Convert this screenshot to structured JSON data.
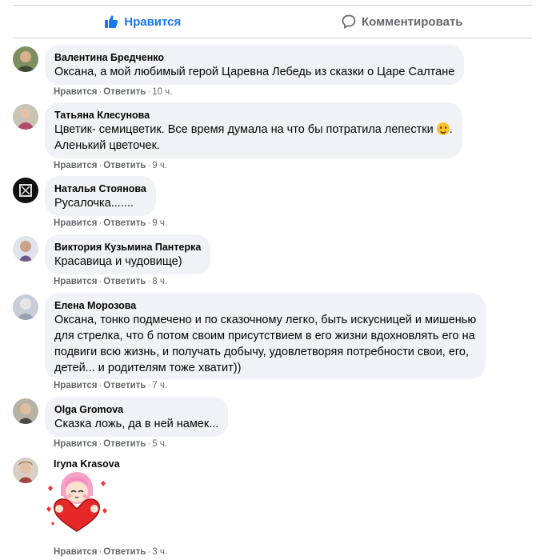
{
  "actions": {
    "like_label": "Нравится",
    "comment_label": "Комментировать"
  },
  "colors": {
    "accent": "#1877f2",
    "bubble": "#f0f2f5",
    "meta": "#65676b"
  },
  "comment_actions": {
    "like": "Нравится",
    "reply": "Ответить",
    "separator": "·"
  },
  "comments": [
    {
      "author": "Валентина Бредченко",
      "lines": [
        "Оксана, а мой любимый герой Царевна Лебедь из сказки о Царе Салтане"
      ],
      "time": "10 ч."
    },
    {
      "author": "Татьяна Клесунова",
      "lines": [
        "Цветик- семицветик. Все время думала на что бы потратила лепестки",
        "Аленький цветочек."
      ],
      "emoji": "grinning-face-emoji",
      "time": "9 ч."
    },
    {
      "author": "Наталья Стоянова",
      "lines": [
        "Русалочка......."
      ],
      "time": "9 ч."
    },
    {
      "author": "Виктория Кузьмина Пантерка",
      "lines": [
        "Красавица и чудовище)"
      ],
      "time": "8 ч."
    },
    {
      "author": "Елена Морозова",
      "lines": [
        "Оксана, тонко подмечено и по сказочному легко, быть искусницей и мишенью",
        "для стрелка, что б потом своим присутствием в его жизни вдохновлять его на",
        "подвиги всю жизнь, и получать добычу, удовлетворяя потребности свои, его,",
        "детей... и родителям тоже хватит))"
      ],
      "time": "7 ч."
    },
    {
      "author": "Olga Gromova",
      "lines": [
        "Сказка ложь, да в ней намек..."
      ],
      "time": "5 ч."
    },
    {
      "author": "Iryna Krasova",
      "sticker": "girl-holding-heart-sticker",
      "time": "3 ч."
    }
  ]
}
